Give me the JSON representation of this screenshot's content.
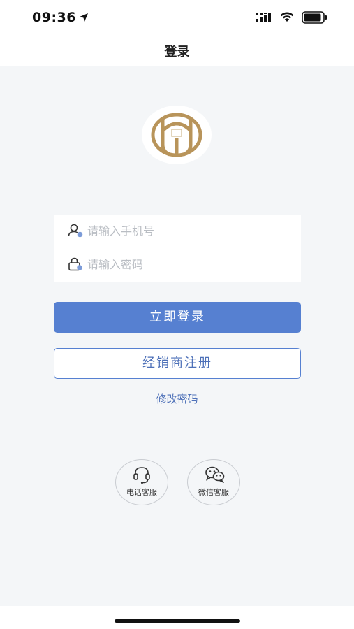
{
  "status_bar": {
    "time": "09:36"
  },
  "nav": {
    "title": "登录"
  },
  "form": {
    "phone_placeholder": "请输入手机号",
    "phone_value": "",
    "password_placeholder": "请输入密码",
    "password_value": ""
  },
  "actions": {
    "login_label": "立即登录",
    "register_label": "经销商注册",
    "change_password_label": "修改密码"
  },
  "service": {
    "phone_label": "电话客服",
    "wechat_label": "微信客服"
  },
  "colors": {
    "accent": "#5680d1",
    "link": "#4d70b8",
    "logo_gold": "#b8945a",
    "background": "#f4f6f8"
  },
  "icons": {
    "logo": "brand-logo-icon",
    "user": "user-icon",
    "lock": "lock-icon",
    "headset": "headset-icon",
    "wechat": "wechat-icon"
  }
}
